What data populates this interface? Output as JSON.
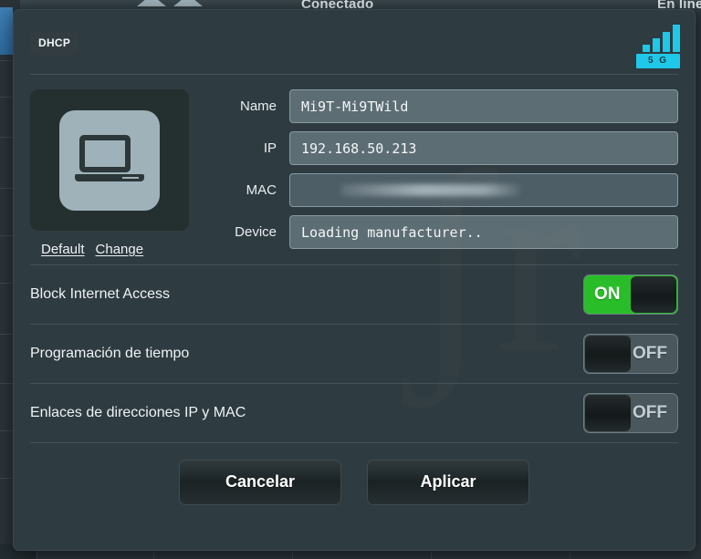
{
  "background": {
    "topbar_left_text": "Conectado",
    "topbar_right_text": "En líne"
  },
  "modal": {
    "header": {
      "badge": "DHCP",
      "signal_icon": "signal-bars-icon",
      "band_label": "5 G"
    },
    "device": {
      "icon": "laptop-icon",
      "default_link": "Default",
      "change_link": "Change"
    },
    "fields": [
      {
        "label": "Name",
        "value": "Mi9T-Mi9TWild",
        "redacted": false
      },
      {
        "label": "IP",
        "value": "192.168.50.213",
        "redacted": false
      },
      {
        "label": "MAC",
        "value": "",
        "redacted": true
      },
      {
        "label": "Device",
        "value": "Loading manufacturer..",
        "redacted": false
      }
    ],
    "toggles": [
      {
        "label": "Block Internet Access",
        "state": "ON"
      },
      {
        "label": "Programación de tiempo",
        "state": "OFF"
      },
      {
        "label": "Enlaces de direcciones IP y MAC",
        "state": "OFF"
      }
    ],
    "footer": {
      "cancel_label": "Cancelar",
      "apply_label": "Aplicar"
    }
  },
  "colors": {
    "modal_bg": "#2e3b40",
    "field_bg": "#5d6d74",
    "accent_cyan": "#1fc8e8",
    "toggle_on_green": "#2abd2a",
    "toggle_off_gray": "#4a585e"
  },
  "watermark_glyph": "ʃr"
}
